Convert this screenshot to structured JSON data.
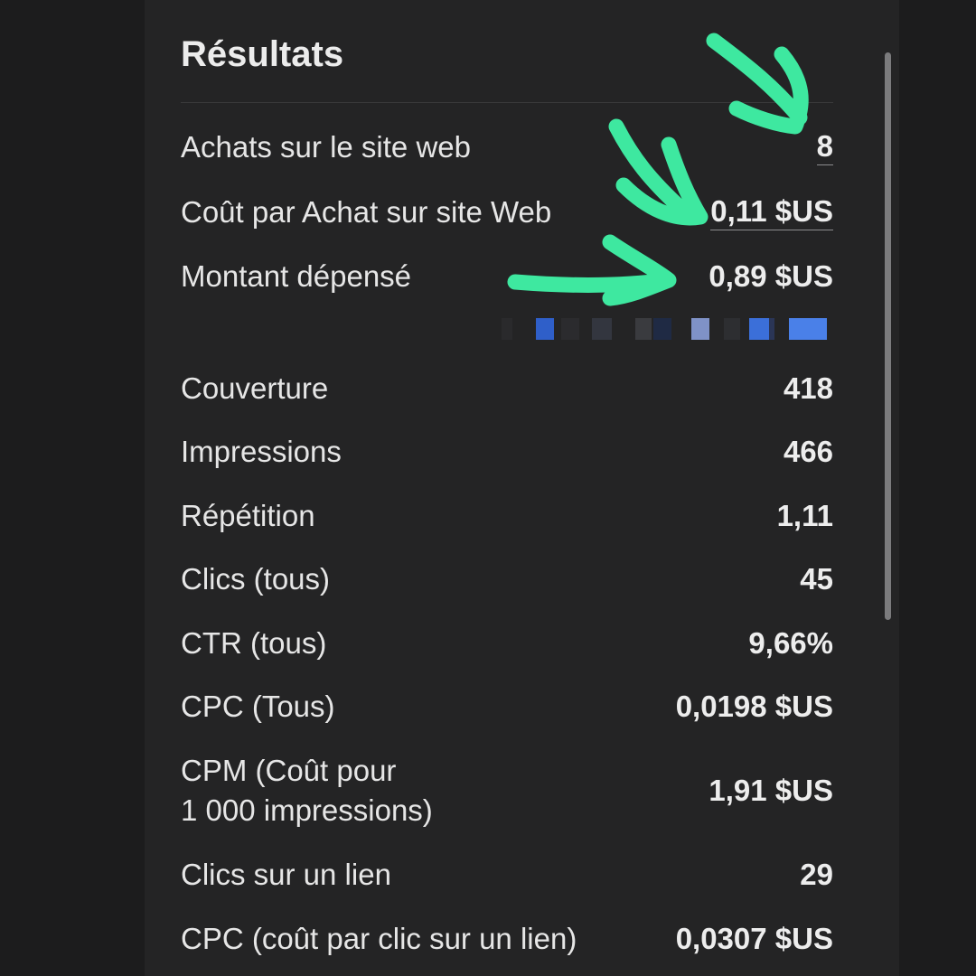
{
  "header": {
    "title": "Résultats"
  },
  "rows": [
    {
      "label": "Achats sur le site web",
      "value": "8"
    },
    {
      "label": "Coût par Achat sur site Web",
      "value": "0,11 $US"
    },
    {
      "label": "Montant dépensé",
      "value": "0,89 $US"
    },
    {
      "label": "Couverture",
      "value": "418"
    },
    {
      "label": "Impressions",
      "value": "466"
    },
    {
      "label": "Répétition",
      "value": "1,11"
    },
    {
      "label": "Clics (tous)",
      "value": "45"
    },
    {
      "label": "CTR (tous)",
      "value": "9,66%"
    },
    {
      "label": "CPC (Tous)",
      "value": "0,0198 $US"
    },
    {
      "label_line1": "CPM (Coût pour",
      "label_line2": "1 000 impressions)",
      "value": "1,91 $US"
    },
    {
      "label": "Clics sur un lien",
      "value": "29"
    },
    {
      "label": "CPC (coût par clic sur un lien)",
      "value": "0,0307 $US"
    }
  ],
  "colors": {
    "background": "#1c1c1d",
    "panel": "#242425",
    "text": "#e6e6e6",
    "annotation_arrow": "#3ee8a0",
    "redaction_blue": "#3a6fd8"
  },
  "annotations": {
    "arrow_icon": "hand-drawn-arrow-icon",
    "redaction": "pixelated-redaction"
  }
}
